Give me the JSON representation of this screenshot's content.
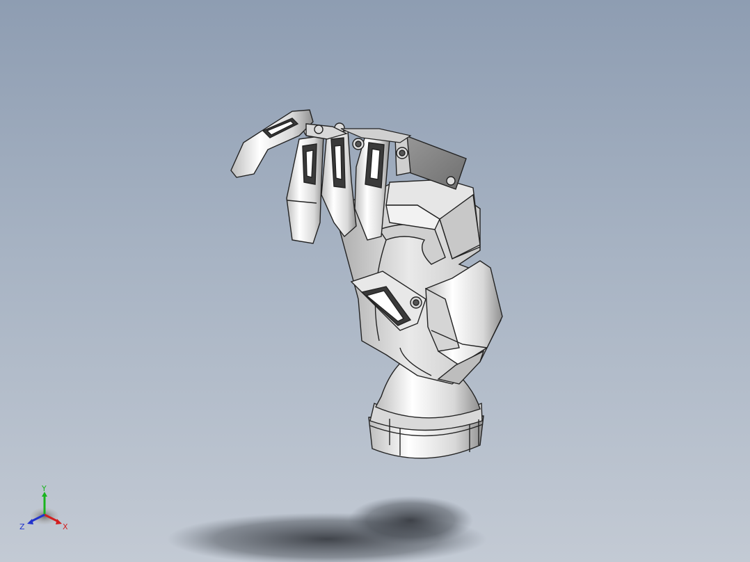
{
  "viewport": {
    "background_top": "#8e9db2",
    "background_bottom": "#c3cad4",
    "model": "robotic-hand-assembly"
  },
  "triad": {
    "x_label": "X",
    "y_label": "Y",
    "z_label": "Z",
    "x_color": "#d21f1f",
    "y_color": "#19b41e",
    "z_color": "#2233cc"
  }
}
